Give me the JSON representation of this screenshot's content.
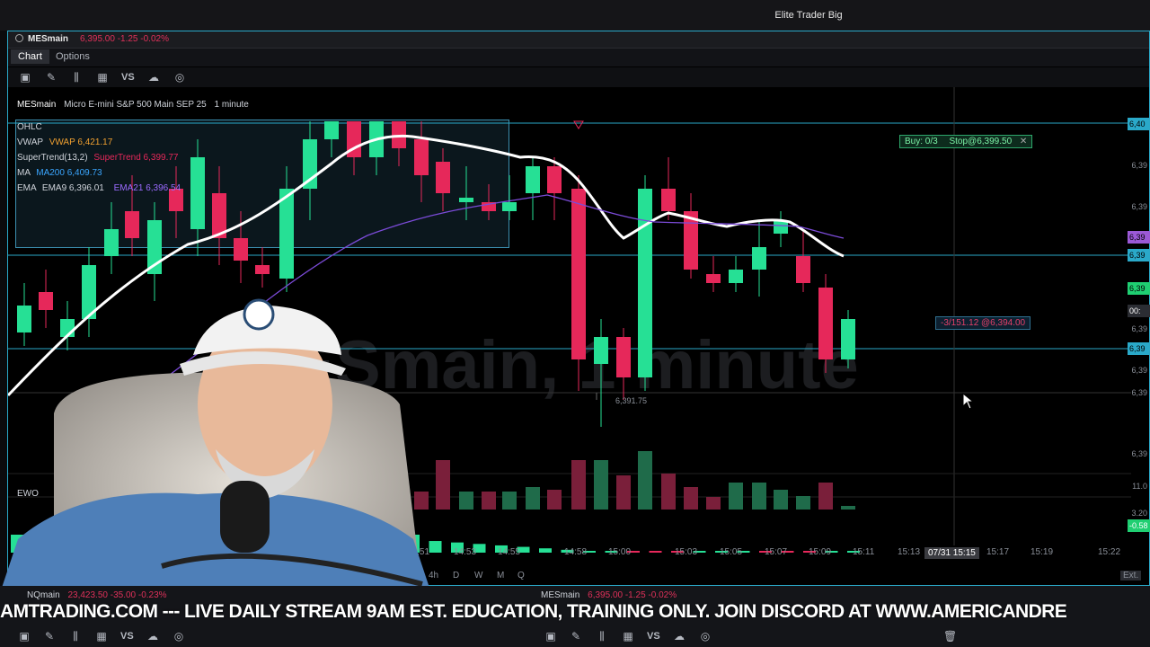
{
  "window": {
    "title": "Elite Trader Big"
  },
  "symbol_bar": {
    "symbol": "MESmain",
    "quote": "6,395.00 -1.25 -0.02%"
  },
  "tabs": [
    {
      "label": "Chart",
      "active": true
    },
    {
      "label": "Options",
      "active": false
    }
  ],
  "chart_header": {
    "symbol": "MESmain",
    "description": "Micro E-mini S&P 500 Main SEP 25",
    "interval": "1 minute"
  },
  "watermark": "MESmain, 1 minute",
  "studies": {
    "ohlc": "OHLC",
    "vwap_label": "VWAP",
    "vwap_value": "VWAP 6,421.17",
    "supertrend_label": "SuperTrend(13,2)",
    "supertrend_value": "SuperTrend 6,399.77",
    "ma_label": "MA",
    "ma_value": "MA200 6,409.73",
    "ema_label": "EMA",
    "ema9_value": "EMA9 6,396.01",
    "ema21_value": "EMA21 6,396.54"
  },
  "orders": {
    "buy": "Buy: 0/3",
    "stop": "Stop@6,399.50",
    "position": "-3/151.12 @6,394.00"
  },
  "low_label": "6,391.75",
  "price_axis": [
    "6,40",
    "6,39",
    "6,39",
    "6,39",
    "6,39",
    "6,39",
    "6,39",
    "6,39",
    "6,39",
    "6,39",
    "6,39",
    "6,39"
  ],
  "price_tags": [
    {
      "text": "6,40",
      "color": "#2aa9c9"
    },
    {
      "text": "6,39",
      "color": "#9b59d6"
    },
    {
      "text": "6,39",
      "color": "#2aa9c9"
    },
    {
      "text": "6,39",
      "color": "#1fcf72"
    },
    {
      "text": "00:",
      "color": "#2b2d33"
    },
    {
      "text": "6,39",
      "color": "#2aa9c9"
    }
  ],
  "lower_axis": {
    "vol": "11.0",
    "osc1": "3.20",
    "osc2": "-0.58"
  },
  "ewo_label": "EWO",
  "time_axis": [
    "14:51",
    "14:53",
    "14:55",
    "14:58",
    "15:00",
    "15:03",
    "15:05",
    "15:07",
    "15:09",
    "15:11",
    "15:13",
    "15:17",
    "15:19",
    "15:22"
  ],
  "time_cursor": "07/31 15:15",
  "aggregation": [
    "4h",
    "D",
    "W",
    "M",
    "Q"
  ],
  "ext_label": "Ext.",
  "bottom": {
    "left_symbol": "NQmain",
    "left_quote": "23,423.50 -35.00 -0.23%",
    "right_symbol": "MESmain",
    "right_quote": "6,395.00 -1.25 -0.02%"
  },
  "ticker_text": "AMTRADING.COM --- LIVE DAILY STREAM 9AM EST. EDUCATION, TRAINING ONLY. JOIN DISCORD AT WWW.AMERICANDRE",
  "colors": {
    "up": "#26e095",
    "down": "#e6285a",
    "accent": "#2aa9c9",
    "vwap": "#ffffff",
    "ema21": "#7b4bd8"
  },
  "chart_data": {
    "type": "candlestick",
    "candles": [
      {
        "o": 6396.0,
        "h": 6397.0,
        "l": 6393.5,
        "c": 6394.5
      },
      {
        "o": 6394.5,
        "h": 6396.0,
        "l": 6394.0,
        "c": 6395.5
      },
      {
        "o": 6395.5,
        "h": 6398.5,
        "l": 6395.0,
        "c": 6398.0
      },
      {
        "o": 6398.0,
        "h": 6400.0,
        "l": 6397.0,
        "c": 6399.5
      }
    ]
  }
}
